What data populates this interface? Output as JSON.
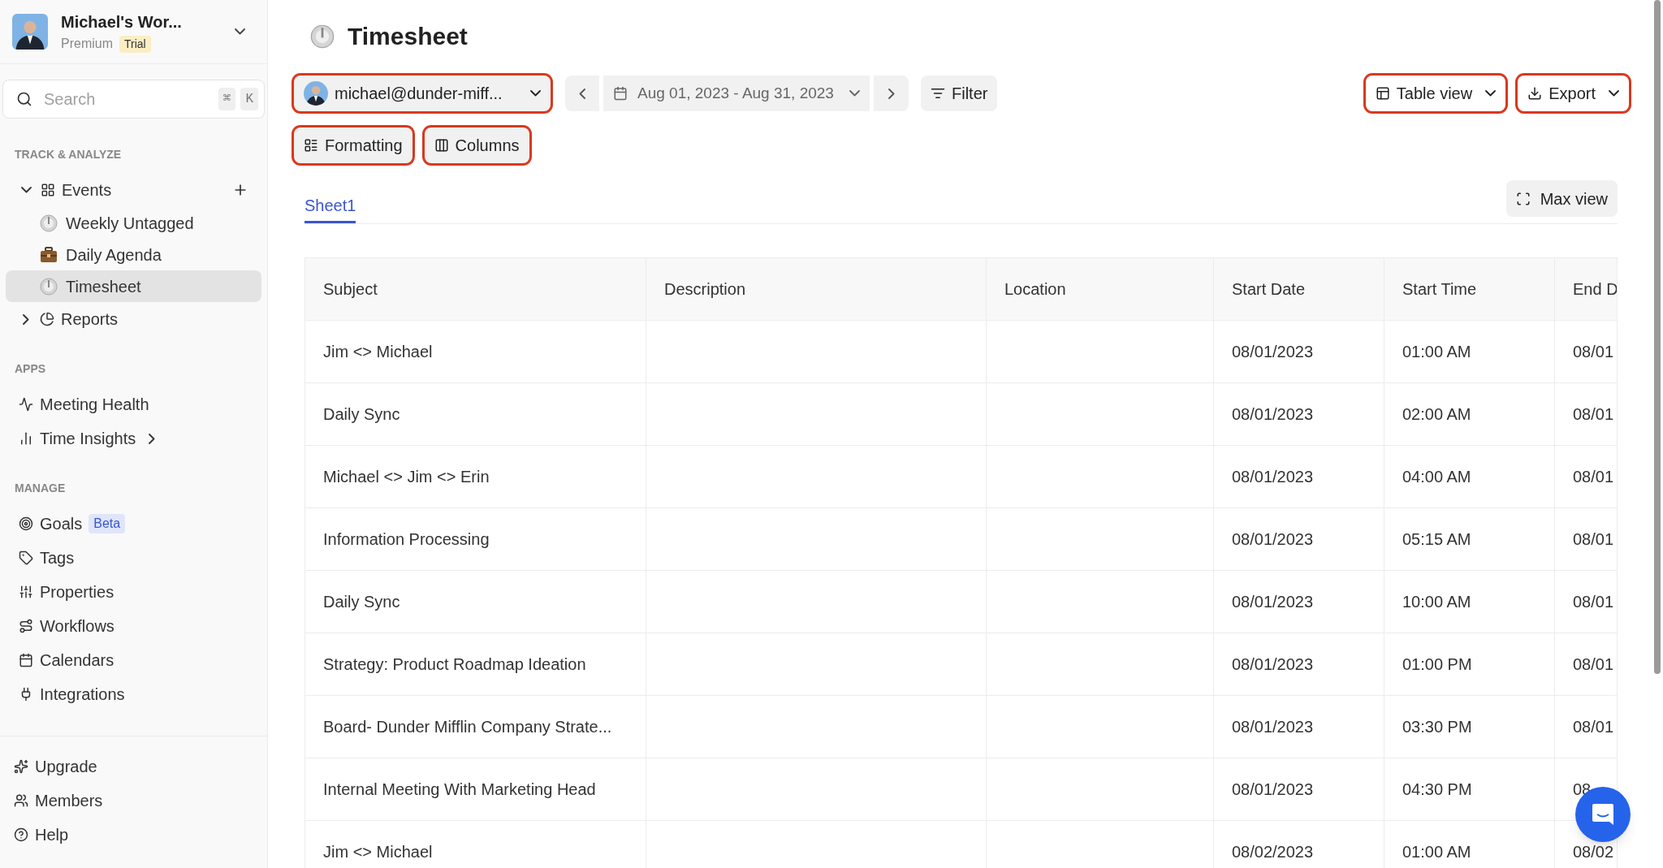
{
  "workspace": {
    "name": "Michael's Wor...",
    "plan": "Premium",
    "badge": "Trial"
  },
  "search": {
    "placeholder": "Search",
    "keys": [
      "⌘",
      "K"
    ]
  },
  "sections": [
    {
      "label": "TRACK & ANALYZE",
      "items": [
        {
          "kind": "tree",
          "label": "Events",
          "expanded": true,
          "selected": false,
          "children": [
            {
              "label": "Weekly Untagged",
              "selected": false
            },
            {
              "label": "Daily Agenda",
              "selected": false
            },
            {
              "label": "Timesheet",
              "selected": true
            }
          ]
        },
        {
          "kind": "tree",
          "label": "Reports",
          "expanded": false,
          "selected": false
        }
      ]
    },
    {
      "label": "APPS",
      "items": [
        {
          "kind": "link",
          "label": "Meeting Health",
          "selected": false
        },
        {
          "kind": "submenu",
          "label": "Time Insights",
          "selected": false
        }
      ]
    },
    {
      "label": "MANAGE",
      "items": [
        {
          "kind": "link",
          "label": "Goals",
          "badge": "Beta",
          "selected": false
        },
        {
          "kind": "link",
          "label": "Tags",
          "selected": false
        },
        {
          "kind": "link",
          "label": "Properties",
          "selected": false
        },
        {
          "kind": "link",
          "label": "Workflows",
          "selected": false
        },
        {
          "kind": "link",
          "label": "Calendars",
          "selected": false
        },
        {
          "kind": "link",
          "label": "Integrations",
          "selected": false
        }
      ]
    }
  ],
  "footer": [
    {
      "label": "Upgrade"
    },
    {
      "label": "Members"
    },
    {
      "label": "Help"
    }
  ],
  "page": {
    "title": "Timesheet"
  },
  "toolbar": {
    "account": {
      "email": "michael@dunder-miff...",
      "highlighted": true
    },
    "date_range": {
      "label": "Aug 01, 2023 - Aug 31, 2023"
    },
    "filter": {
      "label": "Filter",
      "highlighted": false
    },
    "view": {
      "label": "Table view",
      "highlighted": true
    },
    "export": {
      "label": "Export",
      "highlighted": true
    },
    "formatting": {
      "label": "Formatting",
      "highlighted": true
    },
    "columns": {
      "label": "Columns",
      "highlighted": true
    }
  },
  "tabs": [
    {
      "label": "Sheet1",
      "selected": true
    }
  ],
  "max_view": {
    "label": "Max view"
  },
  "table": {
    "columns": [
      "Subject",
      "Description",
      "Location",
      "Start Date",
      "Start Time",
      "End D"
    ],
    "rows": [
      {
        "subject": "Jim <> Michael",
        "start_date": "08/01/2023",
        "start_time": "01:00 AM",
        "end_date": "08/01"
      },
      {
        "subject": "Daily Sync",
        "start_date": "08/01/2023",
        "start_time": "02:00 AM",
        "end_date": "08/01"
      },
      {
        "subject": "Michael <> Jim <> Erin",
        "start_date": "08/01/2023",
        "start_time": "04:00 AM",
        "end_date": "08/01"
      },
      {
        "subject": "Information Processing",
        "start_date": "08/01/2023",
        "start_time": "05:15 AM",
        "end_date": "08/01"
      },
      {
        "subject": "Daily Sync",
        "start_date": "08/01/2023",
        "start_time": "10:00 AM",
        "end_date": "08/01"
      },
      {
        "subject": "Strategy: Product Roadmap Ideation",
        "start_date": "08/01/2023",
        "start_time": "01:00 PM",
        "end_date": "08/01"
      },
      {
        "subject": "Board- Dunder Mifflin Company Strate...",
        "start_date": "08/01/2023",
        "start_time": "03:30 PM",
        "end_date": "08/01"
      },
      {
        "subject": "Internal Meeting With Marketing Head",
        "start_date": "08/01/2023",
        "start_time": "04:30 PM",
        "end_date": "08"
      },
      {
        "subject": "Jim <> Michael",
        "start_date": "08/02/2023",
        "start_time": "01:00 AM",
        "end_date": "08/02"
      }
    ]
  }
}
